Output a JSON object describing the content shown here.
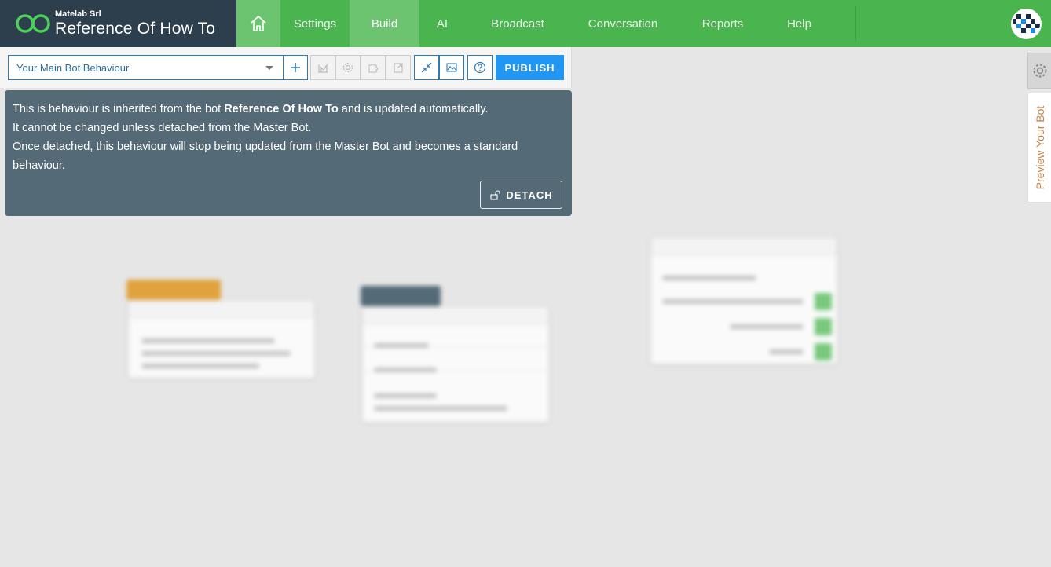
{
  "brand": {
    "company": "Matelab Srl",
    "name": "Reference Of How To"
  },
  "nav": {
    "items": [
      {
        "label": "Settings"
      },
      {
        "label": "Build"
      },
      {
        "label": "AI"
      },
      {
        "label": "Broadcast"
      },
      {
        "label": "Conversation"
      },
      {
        "label": "Reports"
      },
      {
        "label": "Help"
      }
    ],
    "active": "Build"
  },
  "toolbar": {
    "behaviour_select": "Your Main Bot Behaviour",
    "publish_label": "PUBLISH"
  },
  "info": {
    "line1_prefix": "This is behaviour is inherited from the bot ",
    "line1_bot": "Reference Of How To",
    "line1_suffix": " and is updated automatically.",
    "line2": "It cannot be changed unless detached from the Master Bot.",
    "line3": "Once detached, this behaviour will stop being updated from the Master Bot and becomes a standard behaviour.",
    "detach_label": "DETACH"
  },
  "sidebar": {
    "preview_label": "Preview Your Bot"
  },
  "colors": {
    "nav_green": "#4ab54f",
    "nav_active": "#6cc470",
    "brand_bg": "#2d3e4d",
    "info_bg": "#546a77",
    "publish_blue": "#2196f3",
    "preview_text": "#c8844a"
  }
}
